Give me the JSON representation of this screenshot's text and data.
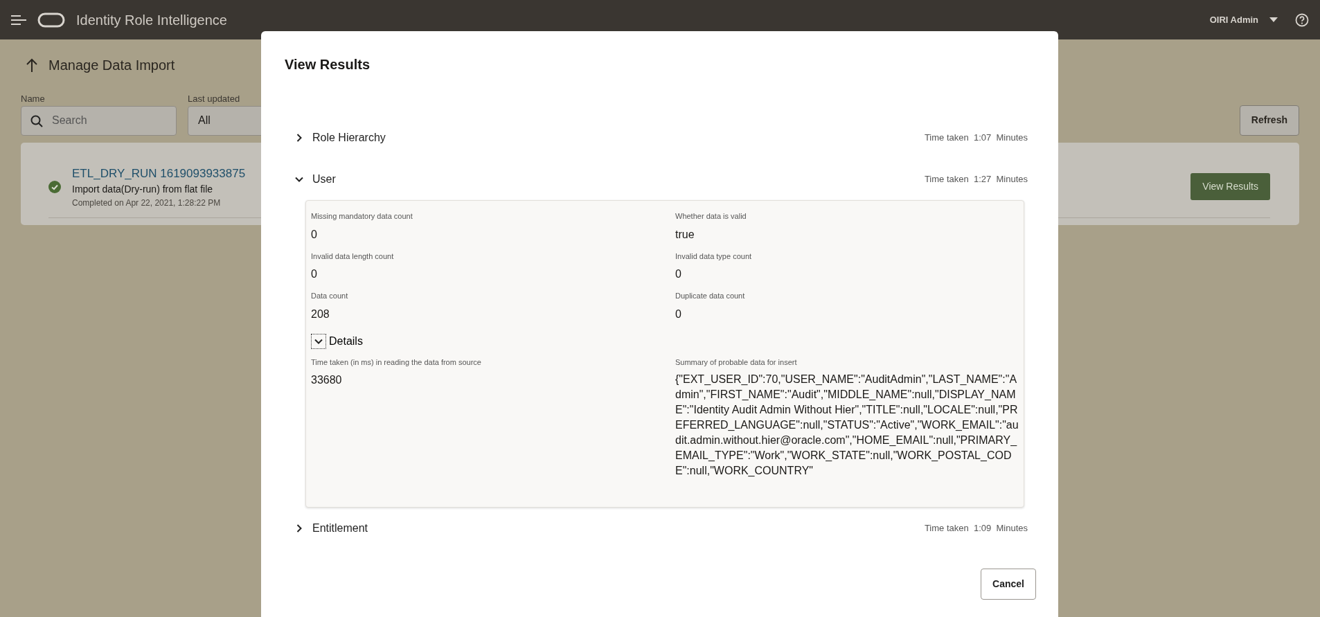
{
  "header": {
    "app_title": "Identity Role Intelligence",
    "user_menu": "OIRI Admin"
  },
  "page": {
    "title": "Manage Data Import",
    "filters": [
      {
        "kind": "search",
        "label": "Name",
        "placeholder": "Search"
      },
      {
        "kind": "select",
        "label": "Last updated",
        "value": "All"
      }
    ],
    "refresh_button": "Refresh",
    "jobs": [
      {
        "name": "ETL_DRY_RUN 1619093933875",
        "description": "Import data(Dry-run) from flat file",
        "completed": "Completed on Apr 22, 2021, 1:28:22 PM",
        "succeeded": true,
        "action": "View Results"
      }
    ]
  },
  "dialog": {
    "title": "View Results",
    "sections": [
      {
        "title": "Role Hierarchy",
        "expanded": false,
        "time_label": "Time taken",
        "time": "1:07",
        "unit": "Minutes"
      },
      {
        "title": "User",
        "expanded": true,
        "time_label": "Time taken",
        "time": "1:27",
        "unit": "Minutes",
        "stats": [
          {
            "label": "Missing mandatory data count",
            "value": "0"
          },
          {
            "label": "Whether data is valid",
            "value": "true"
          },
          {
            "label": "Invalid data length count",
            "value": "0"
          },
          {
            "label": "Invalid data type count",
            "value": "0"
          },
          {
            "label": "Data count",
            "value": "208"
          },
          {
            "label": "Duplicate data count",
            "value": "0"
          }
        ],
        "details": {
          "title": "Details",
          "expanded": true,
          "items": [
            {
              "label": "Time taken (in ms) in reading the data from source",
              "value": "33680"
            },
            {
              "label": "Summary of probable data for insert",
              "value": "{\"EXT_USER_ID\":70,\"USER_NAME\":\"AuditAdmin\",\"LAST_NAME\":\"Admin\",\"FIRST_NAME\":\"Audit\",\"MIDDLE_NAME\":null,\"DISPLAY_NAME\":\"Identity Audit Admin Without Hier\",\"TITLE\":null,\"LOCALE\":null,\"PREFERRED_LANGUAGE\":null,\"STATUS\":\"Active\",\"WORK_EMAIL\":\"audit.admin.without.hier@oracle.com\",\"HOME_EMAIL\":null,\"PRIMARY_EMAIL_TYPE\":\"Work\",\"WORK_STATE\":null,\"WORK_POSTAL_CODE\":null,\"WORK_COUNTRY\""
            }
          ]
        }
      },
      {
        "title": "Entitlement",
        "expanded": false,
        "time_label": "Time taken",
        "time": "1:09",
        "unit": "Minutes"
      }
    ],
    "cancel_button": "Cancel"
  }
}
